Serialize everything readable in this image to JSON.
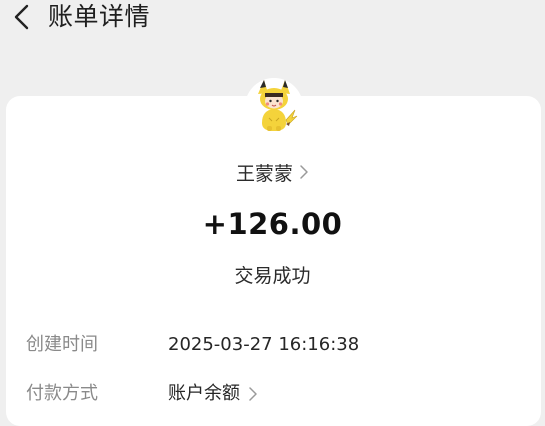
{
  "header": {
    "title": "账单详情",
    "back_icon": "chevron-left-icon"
  },
  "card": {
    "avatar_icon": "pikachu-costume-avatar",
    "payee_name": "王蒙蒙",
    "amount": "+126.00",
    "status": "交易成功",
    "rows": [
      {
        "label": "创建时间",
        "value": "2025-03-27 16:16:38"
      },
      {
        "label": "付款方式",
        "value": "账户余额"
      }
    ]
  }
}
